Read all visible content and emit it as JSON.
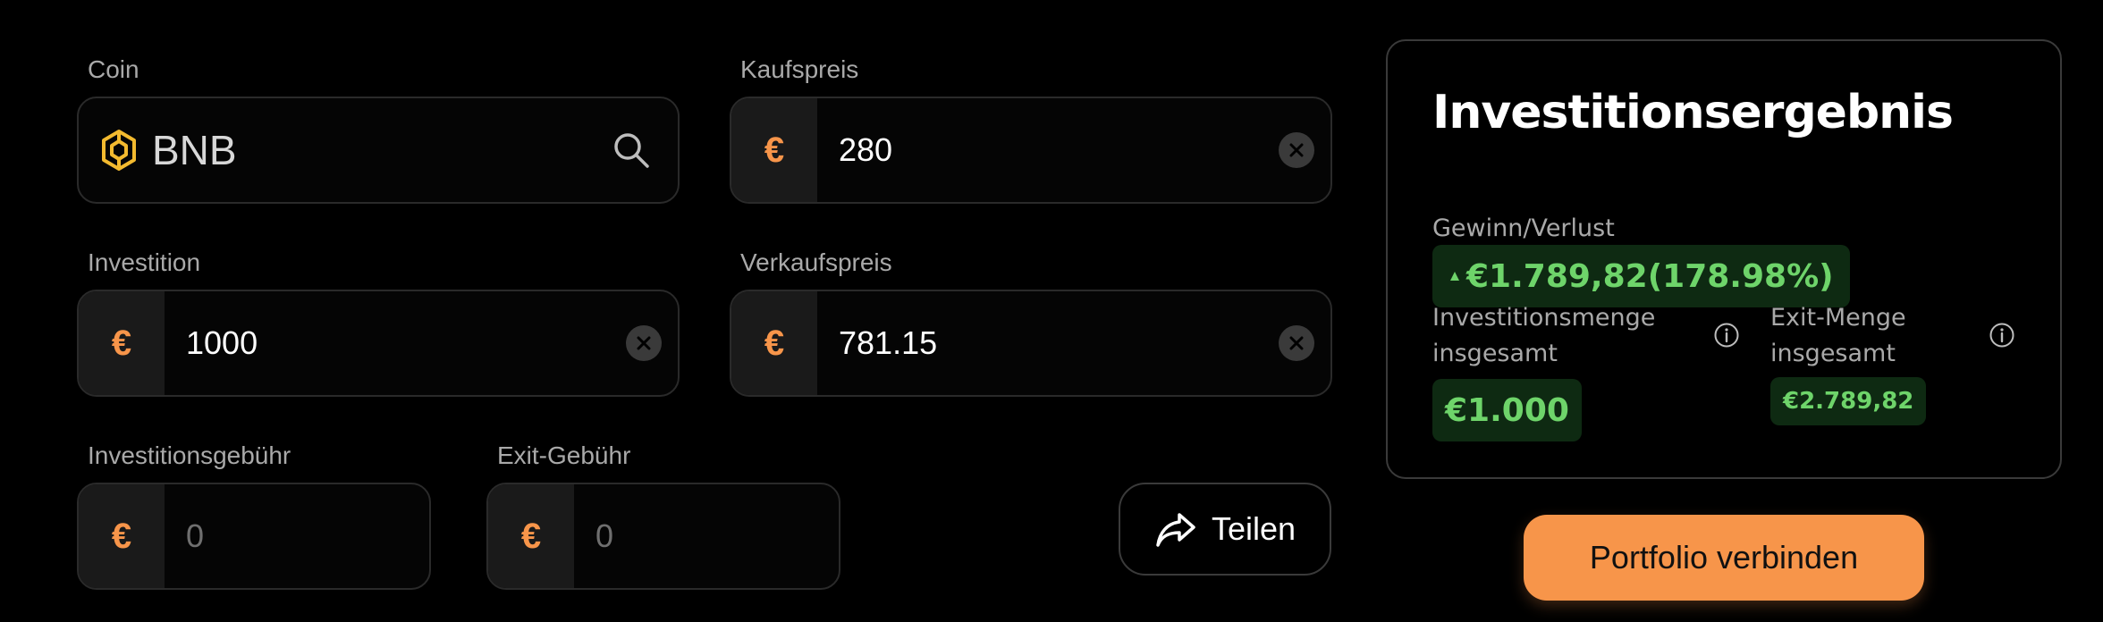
{
  "form": {
    "coin": {
      "label": "Coin",
      "value": "BNB",
      "icon": "bnb-coin-icon"
    },
    "buy_price": {
      "label": "Kaufspreis",
      "currency": "€",
      "value": "280"
    },
    "investment": {
      "label": "Investition",
      "currency": "€",
      "value": "1000"
    },
    "sell_price": {
      "label": "Verkaufspreis",
      "currency": "€",
      "value": "781.15"
    },
    "investment_fee": {
      "label": "Investitionsgebühr",
      "currency": "€",
      "placeholder": "0"
    },
    "exit_fee": {
      "label": "Exit-Gebühr",
      "currency": "€",
      "placeholder": "0"
    },
    "share_label": "Teilen"
  },
  "result": {
    "title": "Investitionsergebnis",
    "profit_label": "Gewinn/Verlust",
    "profit_value": "€1.789,82(178.98%)",
    "total_investment_label_line1": "Investitionsmenge",
    "total_investment_label_line2": "insgesamt",
    "total_investment_value": "€1.000",
    "exit_amount_label_line1": "Exit-Menge",
    "exit_amount_label_line2": "insgesamt",
    "exit_amount_value": "€2.789,82"
  },
  "connect_label": "Portfolio verbinden",
  "colors": {
    "accent": "#f7954a",
    "positive": "#6ed46a",
    "positive_bg": "#0e2a12",
    "bnb": "#f3ba2f"
  }
}
